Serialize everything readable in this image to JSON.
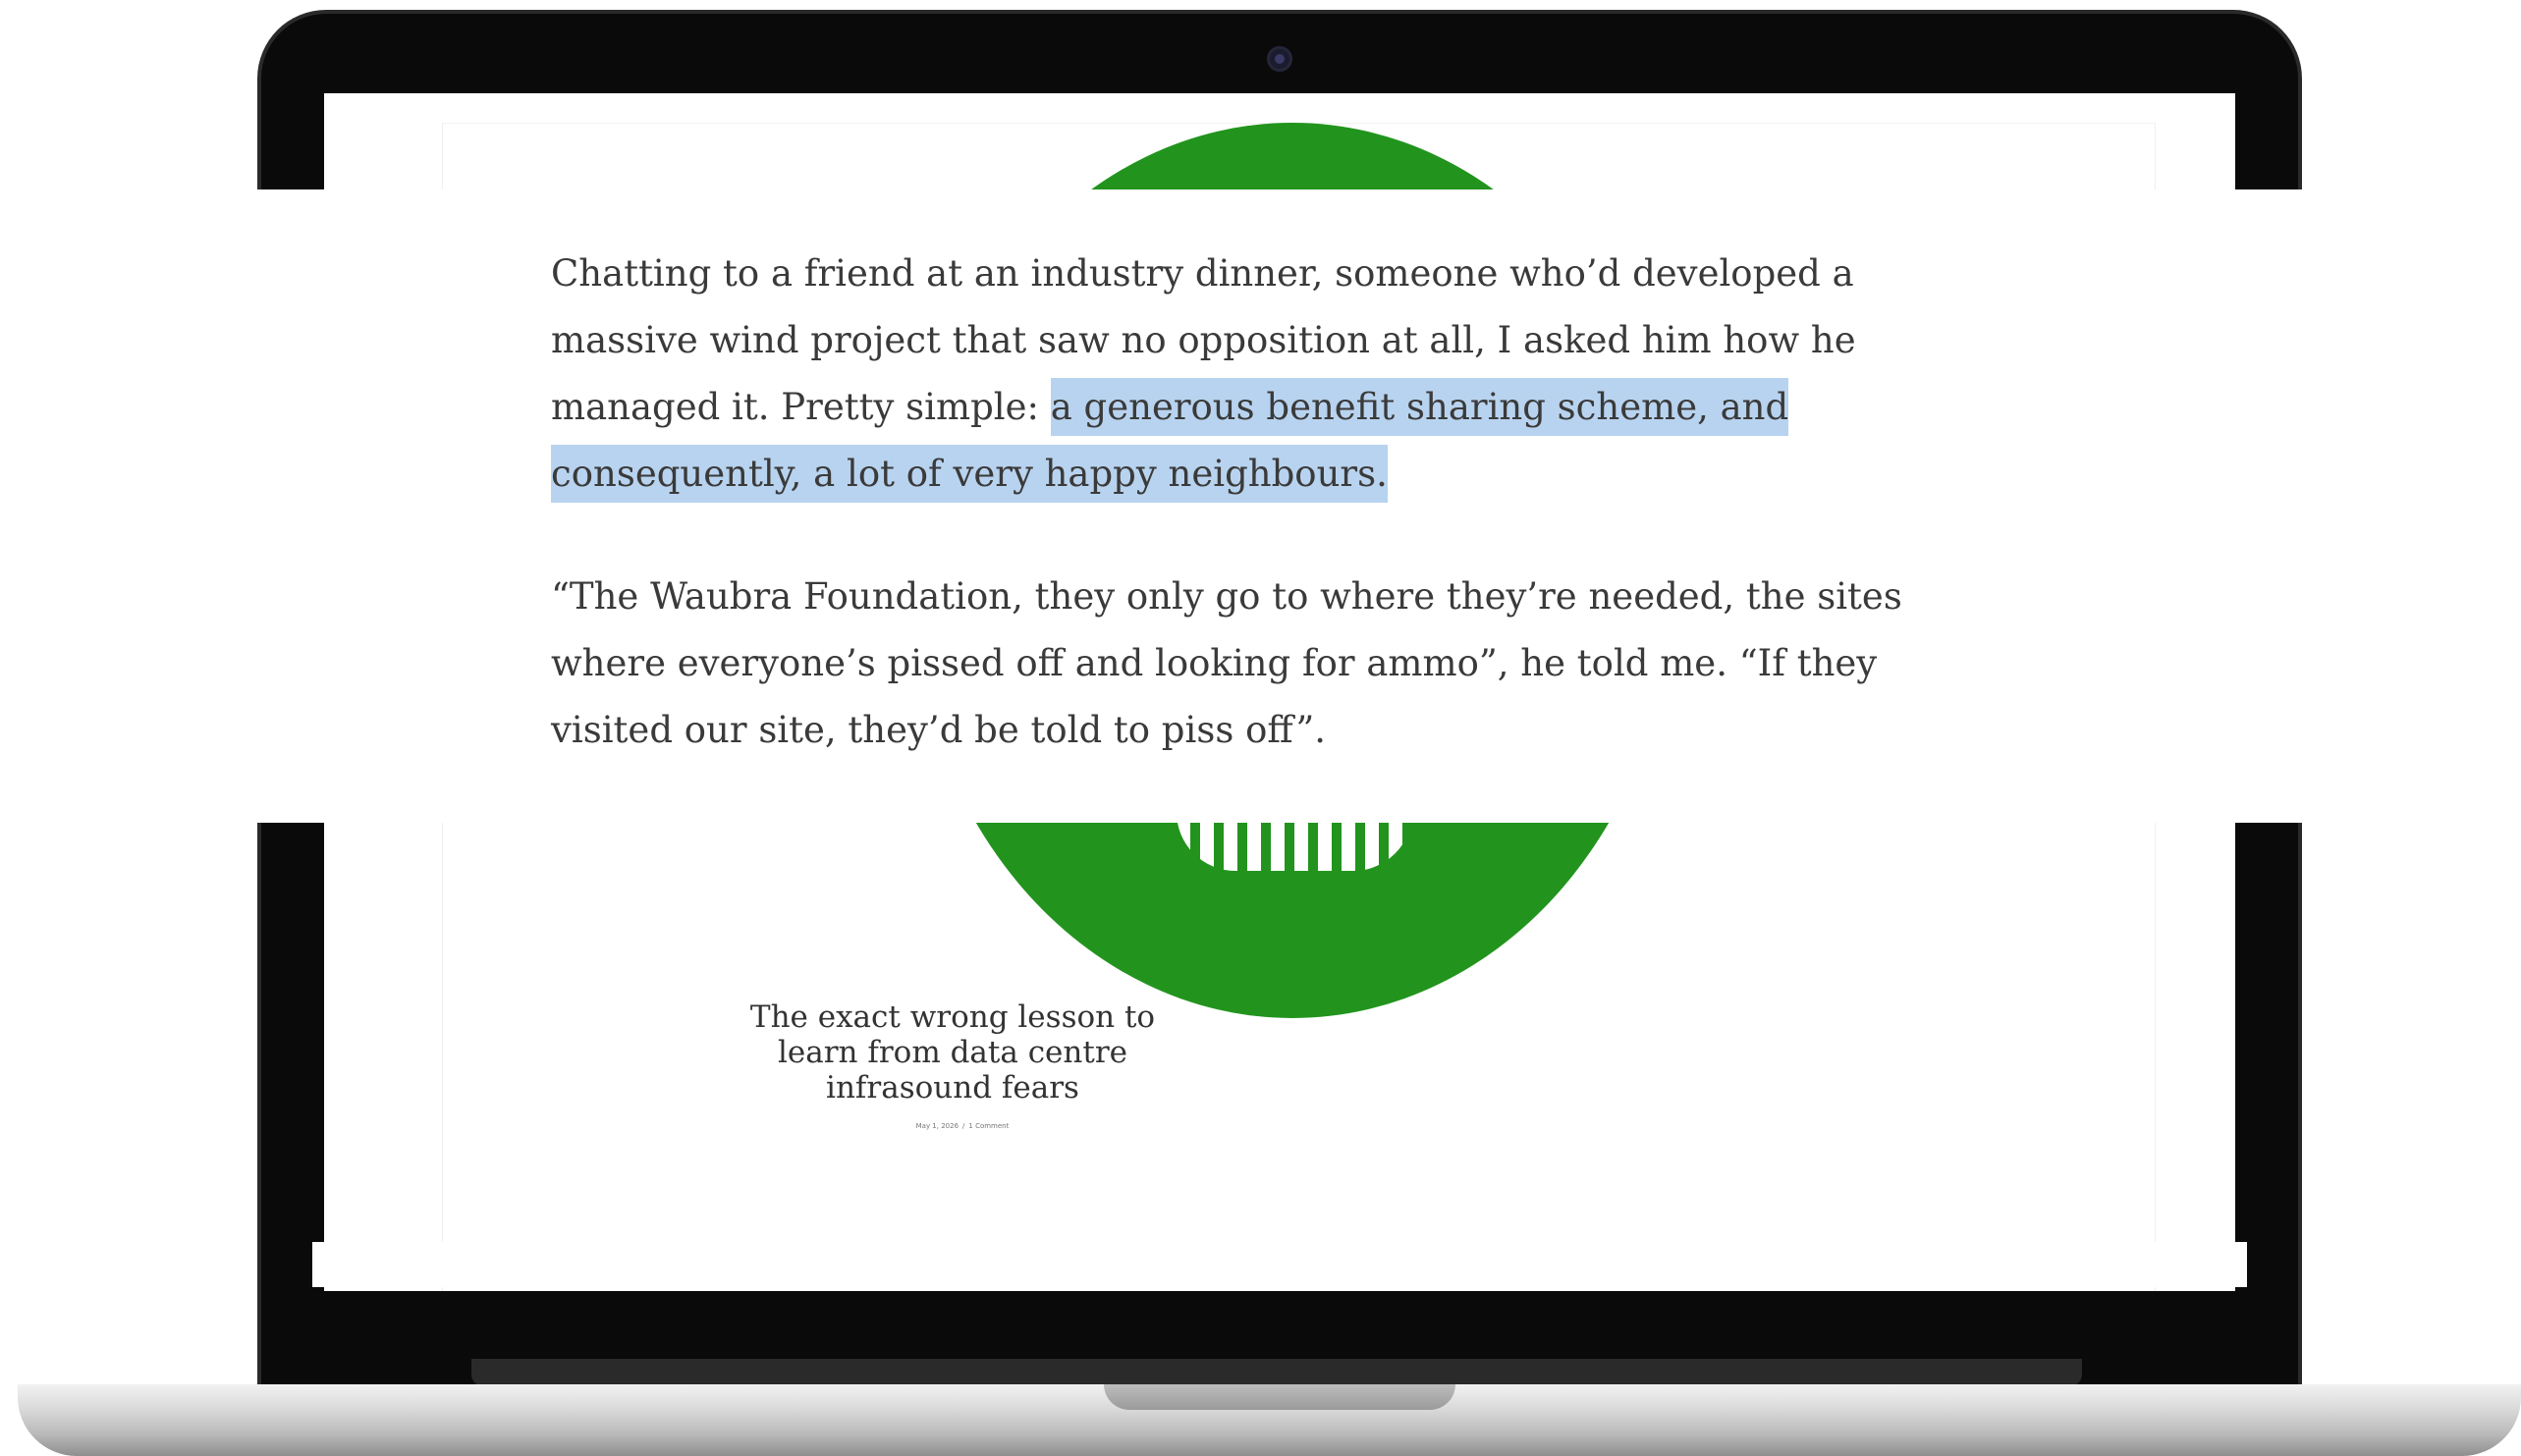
{
  "article": {
    "paragraph_1_plain": "Chatting to a friend at an industry dinner, someone who’d developed a massive wind project that saw no opposition at all, I asked him how he managed it. Pretty simple: ",
    "paragraph_1_highlight": "a generous benefit sharing scheme, and consequently, a lot of very happy neighbours.",
    "paragraph_2": "“The Waubra Foundation, they only go to where they’re needed, the sites where everyone’s pissed off and looking for ammo”, he told me. “If they visited our site, they’d be told to piss off”."
  },
  "screen": {
    "post_title": "The exact wrong lesson to learn from data centre infrasound fears",
    "post_meta_date": "May 1, 2026",
    "post_meta_separator": "/",
    "post_meta_comments": "1 Comment"
  },
  "colors": {
    "logo_green": "#22941d",
    "highlight": "#b8d3ef",
    "text": "#3a3a3a"
  }
}
